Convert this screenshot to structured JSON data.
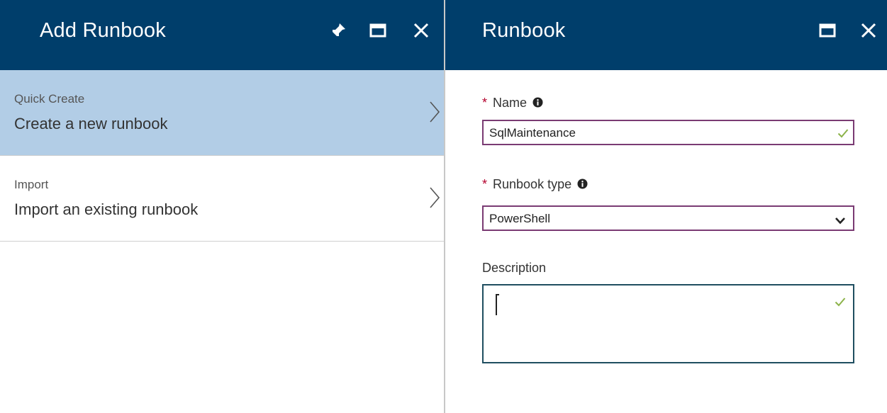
{
  "colors": {
    "header_bg": "#003e6b",
    "selected_item_bg": "#b2cde6",
    "required_star": "#b4002d",
    "valid_check": "#8cb34a",
    "input_border": "#7a3b73"
  },
  "left_blade": {
    "title": "Add Runbook",
    "buttons": [
      "pin-icon",
      "maximize-icon",
      "close-icon"
    ],
    "items": [
      {
        "title": "Quick Create",
        "subtitle": "Create a new runbook",
        "selected": true
      },
      {
        "title": "Import",
        "subtitle": "Import an existing runbook",
        "selected": false
      }
    ]
  },
  "right_blade": {
    "title": "Runbook",
    "buttons": [
      "maximize-icon",
      "close-icon"
    ],
    "form": {
      "name": {
        "label": "Name",
        "required_mark": "*",
        "value": "SqlMaintenance",
        "valid": true
      },
      "runbook_type": {
        "label": "Runbook type",
        "required_mark": "*",
        "selected": "PowerShell"
      },
      "description": {
        "label": "Description",
        "value": "",
        "valid": true
      }
    }
  }
}
